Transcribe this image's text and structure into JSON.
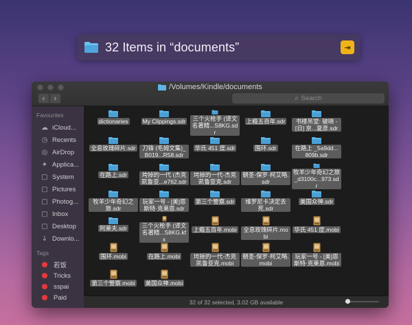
{
  "search_panel": {
    "title": "32 Items in “documents”",
    "action_glyph": "⇥",
    "folder_icon": "folder-icon",
    "accent": "#f1b418"
  },
  "window": {
    "path": "/Volumes/Kindle/documents",
    "nav_back": "‹",
    "nav_forward": "›",
    "search_placeholder": "Search"
  },
  "sidebar": {
    "favourites_label": "Favourites",
    "items": [
      {
        "label": "iCloud...",
        "icon": "cloud-icon",
        "glyph": "☁"
      },
      {
        "label": "Recents",
        "icon": "clock-icon",
        "glyph": "◷"
      },
      {
        "label": "AirDrop",
        "icon": "airdrop-icon",
        "glyph": "◎"
      },
      {
        "label": "Applica...",
        "icon": "applications-icon",
        "glyph": "✦"
      },
      {
        "label": "System",
        "icon": "folder-icon",
        "glyph": "▢"
      },
      {
        "label": "Pictures",
        "icon": "pictures-icon",
        "glyph": "▢"
      },
      {
        "label": "Photog...",
        "icon": "folder-icon",
        "glyph": "▢"
      },
      {
        "label": "Inbox",
        "icon": "folder-icon",
        "glyph": "▢"
      },
      {
        "label": "Desktop",
        "icon": "desktop-icon",
        "glyph": "▢"
      },
      {
        "label": "Downlo...",
        "icon": "download-icon",
        "glyph": "↓"
      }
    ],
    "tags_label": "Tags",
    "tags": [
      {
        "label": "若饭",
        "color": "#e5393b"
      },
      {
        "label": "Tricks",
        "color": "#e5393b"
      },
      {
        "label": "sspai",
        "color": "#e5393b"
      },
      {
        "label": "Paid",
        "color": "#e5393b"
      }
    ]
  },
  "files": [
    {
      "name": "dictionaries",
      "kind": "folder"
    },
    {
      "name": "My Clippings.sdr",
      "kind": "folder"
    },
    {
      "name": "三个火枪手 (译文名著精...S8KG.sdr",
      "kind": "folder"
    },
    {
      "name": "上瘾五百年.sdr",
      "kind": "folder"
    },
    {
      "name": "书楼吊堂: 破晓 - [日] 京...夏彦.sdr",
      "kind": "folder"
    },
    {
      "name": "全息玫瑰碎片.sdr",
      "kind": "folder"
    },
    {
      "name": "刀锋 (毛姆文集)_B019...R58.sdr",
      "kind": "folder"
    },
    {
      "name": "华氏 451 度.sdr",
      "kind": "folder"
    },
    {
      "name": "围环.sdr",
      "kind": "folder"
    },
    {
      "name": "在路上 _5a9dd...809b.sdr",
      "kind": "folder"
    },
    {
      "name": "在路上.sdr",
      "kind": "folder"
    },
    {
      "name": "垮掉的一代 (杰克凯鲁亚...e762.sdr",
      "kind": "folder"
    },
    {
      "name": "垮掉的一代-杰克凯鲁亚克.sdr",
      "kind": "folder"
    },
    {
      "name": "朝圣-保罗·柯艾略.sdr",
      "kind": "folder"
    },
    {
      "name": "牧羊少年奇幻之旅_d3100c...973.sdr",
      "kind": "folder"
    },
    {
      "name": "牧羊少年奇幻之旅.sdr",
      "kind": "folder"
    },
    {
      "name": "玩家一号 - [美]恩斯特·克莱恩.sdr",
      "kind": "folder"
    },
    {
      "name": "第三个警察.sdr",
      "kind": "folder"
    },
    {
      "name": "维罗尼卡决定去死.sdr",
      "kind": "folder"
    },
    {
      "name": "美国众神.sdr",
      "kind": "folder"
    },
    {
      "name": "阿莱夫.sdr",
      "kind": "folder"
    },
    {
      "name": "三个火枪手 (译文名著精...S8KG.kfx",
      "kind": "book"
    },
    {
      "name": "上瘾五百年.mobi",
      "kind": "book"
    },
    {
      "name": "全息玫瑰碎片.mobi",
      "kind": "book"
    },
    {
      "name": "华氏 451 度.mobi",
      "kind": "book"
    },
    {
      "name": "围环.mobi",
      "kind": "book"
    },
    {
      "name": "在路上.mobi",
      "kind": "book"
    },
    {
      "name": "垮掉的一代-杰克凯鲁亚克.mobi",
      "kind": "book"
    },
    {
      "name": "朝圣-保罗·柯艾略.mobi",
      "kind": "book"
    },
    {
      "name": "玩家一号 - [美]恩斯特·克莱恩.mobi",
      "kind": "book"
    },
    {
      "name": "第三个警察.mobi",
      "kind": "book"
    },
    {
      "name": "美国众神.mobi",
      "kind": "book"
    }
  ],
  "status": {
    "text": "32 of 32 selected, 3.02 GB available",
    "zoom_level": 0.05
  },
  "colors": {
    "folder": "#5fb4e6",
    "book": "#b98a4a",
    "tag_red": "#e5393b"
  }
}
